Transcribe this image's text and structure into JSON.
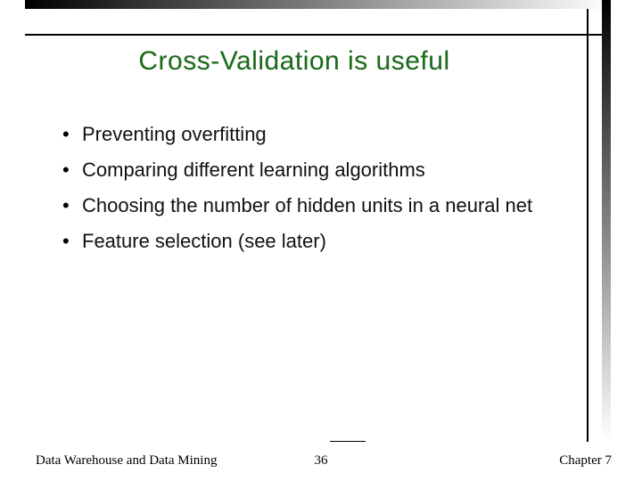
{
  "title": "Cross-Validation is useful",
  "bullets": [
    "Preventing overfitting",
    "Comparing different learning algorithms",
    "Choosing the number of hidden units in a neural net",
    "Feature selection (see later)"
  ],
  "footer": {
    "left": "Data Warehouse and Data Mining",
    "center": "36",
    "right": "Chapter 7"
  }
}
